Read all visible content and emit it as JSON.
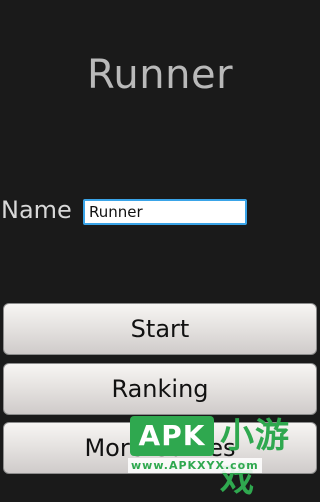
{
  "app": {
    "title": "Runner"
  },
  "name_field": {
    "label": "Name",
    "value": "Runner"
  },
  "buttons": {
    "start": "Start",
    "ranking": "Ranking",
    "more_games": "More Games"
  },
  "watermark": {
    "brand": "APK",
    "chinese": "小游戏",
    "url": "www.APKXYX.com",
    "color": "#2fa84f"
  },
  "colors": {
    "background": "#1a1a1a",
    "title": "#b9b9b9",
    "input_focus_border": "#3aa4e8"
  }
}
